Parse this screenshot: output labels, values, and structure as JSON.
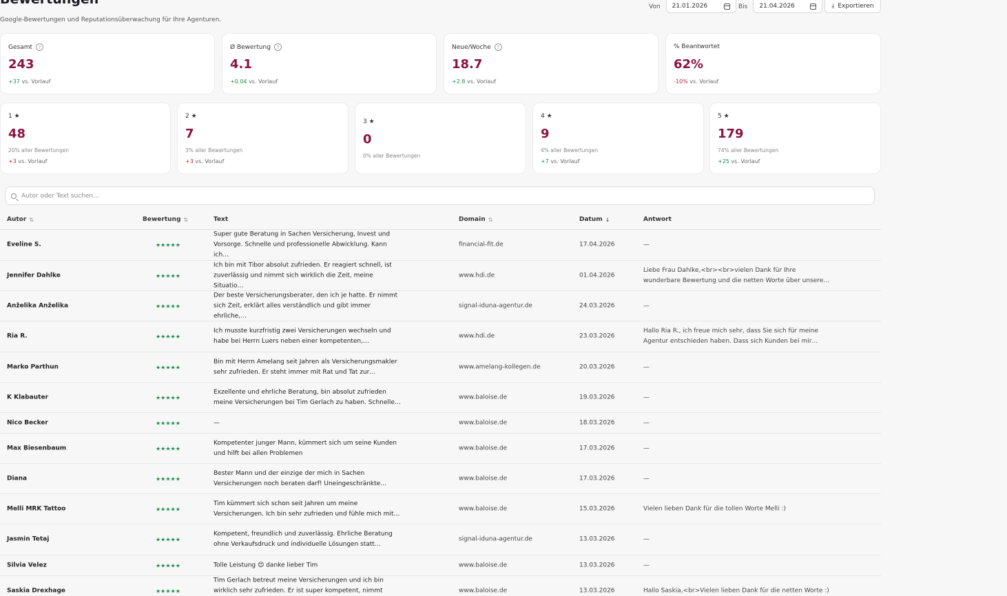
{
  "header": {
    "title": "Bewertungen",
    "subtitle": "Google-Bewertungen und Reputationsüberwachung für Ihre Agenturen.",
    "from_label": "Von",
    "from_date": "21.01.2026",
    "to_label": "Bis",
    "to_date": "21.04.2026",
    "export_label": "Exportieren"
  },
  "kpis": [
    {
      "label": "Gesamt",
      "value": "243",
      "delta": "+37",
      "delta_type": "pos",
      "suffix": "vs. Vorlauf"
    },
    {
      "label": "Ø Bewertung",
      "value": "4.1",
      "delta": "+0.04",
      "delta_type": "pos",
      "suffix": "vs. Vorlauf"
    },
    {
      "label": "Neue/Woche",
      "value": "18.7",
      "delta": "+2.8",
      "delta_type": "pos",
      "suffix": "vs. Vorlauf"
    },
    {
      "label": "% Beantwortet",
      "value": "62%",
      "delta": "-10%",
      "delta_type": "neg",
      "suffix": "vs. Vorlauf"
    }
  ],
  "stars": [
    {
      "label": "1 ★",
      "value": "48",
      "share": "20% aller Bewertungen",
      "delta": "+3",
      "delta_type": "neg",
      "suffix": "vs. Vorlauf"
    },
    {
      "label": "2 ★",
      "value": "7",
      "share": "3% aller Bewertungen",
      "delta": "+3",
      "delta_type": "neg",
      "suffix": "vs. Vorlauf"
    },
    {
      "label": "3 ★",
      "value": "0",
      "share": "0% aller Bewertungen",
      "delta": "",
      "delta_type": "",
      "suffix": ""
    },
    {
      "label": "4 ★",
      "value": "9",
      "share": "4% aller Bewertungen",
      "delta": "+7",
      "delta_type": "pos",
      "suffix": "vs. Vorlauf"
    },
    {
      "label": "5 ★",
      "value": "179",
      "share": "74% aller Bewertungen",
      "delta": "+25",
      "delta_type": "pos",
      "suffix": "vs. Vorlauf"
    }
  ],
  "search": {
    "placeholder": "Autor oder Text suchen..."
  },
  "columns": {
    "author": "Autor",
    "rating": "Bewertung",
    "text": "Text",
    "domain": "Domain",
    "date": "Datum",
    "answer": "Antwort"
  },
  "rows": [
    {
      "author": "Eveline S.",
      "rating": "★★★★★",
      "text": "Super gute Beratung in Sachen Versicherung, Invest und Vorsorge. Schnelle und professionelle Abwicklung. Kann ich…",
      "domain": "financial-fit.de",
      "date": "17.04.2026",
      "answer": "—"
    },
    {
      "author": "Jennifer Dahlke",
      "rating": "★★★★★",
      "text": "Ich bin mit Tibor absolut zufrieden. Er reagiert schnell, ist zuverlässig und nimmt sich wirklich die Zeit, meine Situatio…",
      "domain": "www.hdi.de",
      "date": "01.04.2026",
      "answer": "Liebe Frau Dahlke,<br><br>vielen Dank für Ihre wunderbare Bewertung und die netten Worte über unsere…"
    },
    {
      "author": "Anželika Anželika",
      "rating": "★★★★★",
      "text": "Der beste Versicherungsberater, den ich je hatte. Er nimmt sich Zeit, erklärt alles verständlich und gibt immer ehrliche,…",
      "domain": "signal-iduna-agentur.de",
      "date": "24.03.2026",
      "answer": "—"
    },
    {
      "author": "Ria R.",
      "rating": "★★★★★",
      "text": "Ich musste kurzfristig zwei Versicherungen wechseln und habe bei Herrn Luers neben einer kompetenten,…",
      "domain": "www.hdi.de",
      "date": "23.03.2026",
      "answer": "Hallo Ria R., ich freue mich sehr, dass Sie sich für meine Agentur entschieden haben. Dass sich Kunden bei mir…"
    },
    {
      "author": "Marko Parthun",
      "rating": "★★★★★",
      "text": "Bin mit Herrn Amelang seit Jahren als Versicherungsmakler sehr zufrieden. Er steht immer mit Rat und Tat zur…",
      "domain": "www.amelang-kollegen.de",
      "date": "20.03.2026",
      "answer": "—"
    },
    {
      "author": "K Klabauter",
      "rating": "★★★★★",
      "text": "Exzellente und ehrliche Beratung, bin absolut zufrieden meine Versicherungen bei Tim Gerlach zu haben. Schnelle…",
      "domain": "www.baloise.de",
      "date": "19.03.2026",
      "answer": "—"
    },
    {
      "author": "Nico Becker",
      "rating": "★★★★★",
      "text": "—",
      "domain": "www.baloise.de",
      "date": "18.03.2026",
      "answer": "—"
    },
    {
      "author": "Max Biesenbaum",
      "rating": "★★★★★",
      "text": "Kompetenter junger Mann, kümmert sich um seine Kunden und hilft bei allen Problemen",
      "domain": "www.baloise.de",
      "date": "17.03.2026",
      "answer": "—"
    },
    {
      "author": "Diana",
      "rating": "★★★★★",
      "text": "Bester Mann und der einzige der mich in Sachen Versicherungen noch beraten darf! Uneingeschränkte…",
      "domain": "www.baloise.de",
      "date": "17.03.2026",
      "answer": "—"
    },
    {
      "author": "Melli MRK Tattoo",
      "rating": "★★★★★",
      "text": "Tim kümmert sich schon seit Jahren um meine Versicherungen. Ich bin sehr zufrieden und fühle mich mit…",
      "domain": "www.baloise.de",
      "date": "15.03.2026",
      "answer": "Vielen lieben Dank für die tollen Worte Melli :)"
    },
    {
      "author": "Jasmin Tetaj",
      "rating": "★★★★★",
      "text": "Kompetent, freundlich und zuverlässig. Ehrliche Beratung ohne Verkaufsdruck und individuelle Lösungen statt…",
      "domain": "signal-iduna-agentur.de",
      "date": "13.03.2026",
      "answer": "—"
    },
    {
      "author": "Silvia Velez",
      "rating": "★★★★★",
      "text": "Tolle Leistung 😊 danke lieber Tim",
      "domain": "www.baloise.de",
      "date": "13.03.2026",
      "answer": "—"
    },
    {
      "author": "Saskia Drexhage",
      "rating": "★★★★★",
      "text": "Tim Gerlach betreut meine Versicherungen und ich bin wirklich sehr zufrieden. Er ist super kompetent, nimmt sich…",
      "domain": "www.baloise.de",
      "date": "13.03.2026",
      "answer": "Hallo Saskia,<br>Vielen lieben Dank für die netten Worte :)"
    }
  ],
  "colors": {
    "accent": "#8a1340",
    "positive": "#1c8b4f",
    "negative": "#c0213b"
  }
}
